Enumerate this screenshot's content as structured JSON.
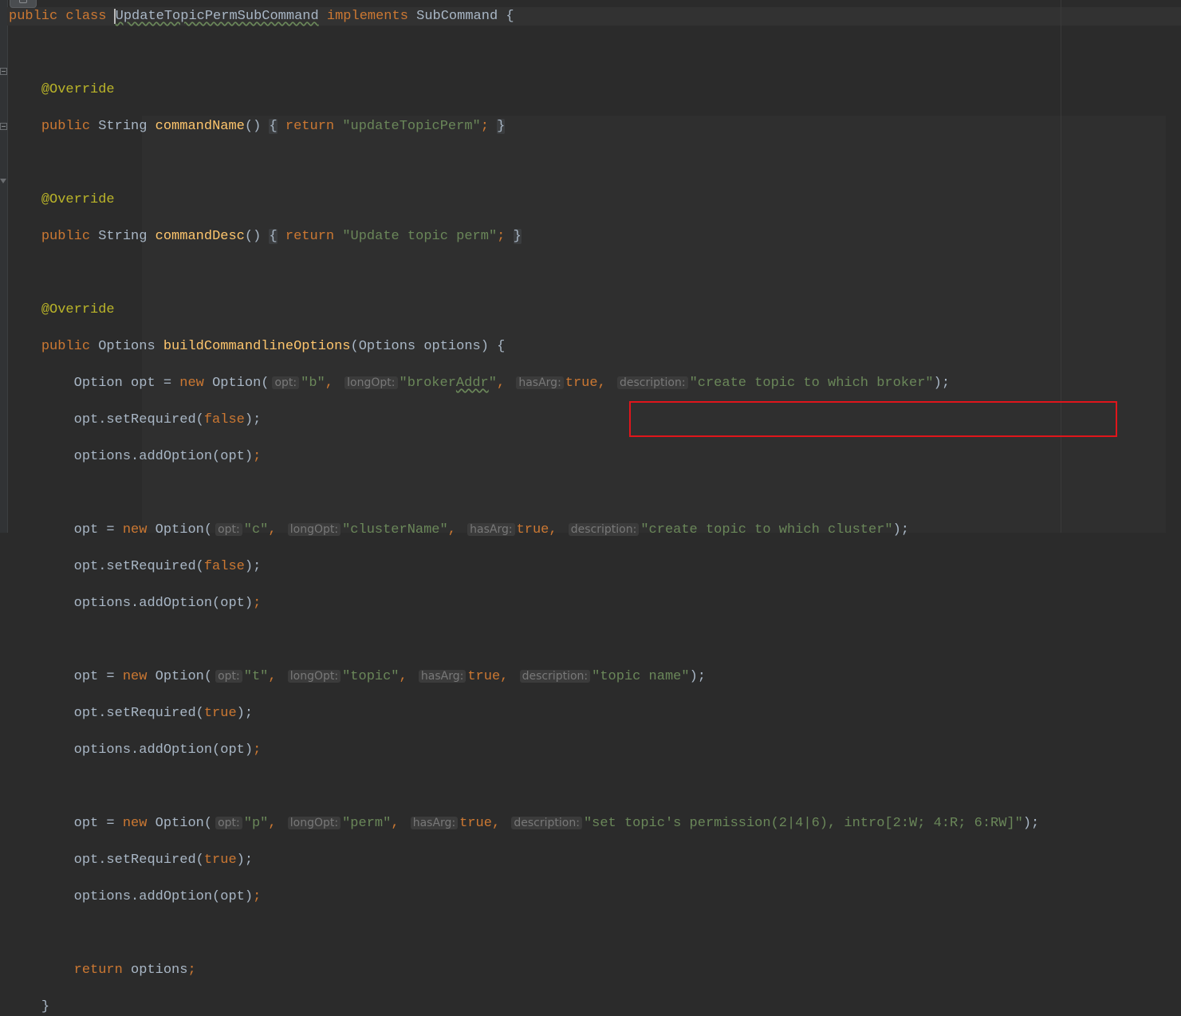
{
  "editor": {
    "class_decl": {
      "kw_public": "public",
      "kw_class": "class",
      "class_name": "UpdateTopicPermSubCommand",
      "kw_implements": "implements",
      "interface": "SubCommand",
      "open_brace": "{"
    },
    "annotation": "@Override",
    "method1": {
      "kw_public": "public",
      "type": "String",
      "name": "commandName",
      "parens": "()",
      "ob": "{",
      "kw_return": "return",
      "value": "\"updateTopicPerm\"",
      "semi": ";",
      "cb": "}"
    },
    "method2": {
      "kw_public": "public",
      "type": "String",
      "name": "commandDesc",
      "parens": "()",
      "ob": "{",
      "kw_return": "return",
      "value": "\"Update topic perm\"",
      "semi": ";",
      "cb": "}"
    },
    "method3": {
      "kw_public": "public",
      "type": "Options",
      "name": "buildCommandlineOptions",
      "params": "(Options options) {"
    },
    "hints": {
      "opt": "opt:",
      "longOpt": "longOpt:",
      "hasArg": "hasArg:",
      "description": "description:"
    },
    "kw_new": "new",
    "kw_true": "true",
    "kw_false": "false",
    "kw_return": "return",
    "option1": {
      "lhs": "Option opt = ",
      "ctor": "Option(",
      "opt": "\"b\"",
      "longOpt_a": "\"broker",
      "longOpt_b": "Addr",
      "longOpt_c": "\"",
      "description": "\"create topic to which broker\""
    },
    "option2": {
      "lhs": "opt = ",
      "ctor": "Option(",
      "opt": "\"c\"",
      "longOpt": "\"clusterName\"",
      "description": "\"create topic to which cluster\""
    },
    "option3": {
      "lhs": "opt = ",
      "ctor": "Option(",
      "opt": "\"t\"",
      "longOpt": "\"topic\"",
      "description": "\"topic name\""
    },
    "option4": {
      "lhs": "opt = ",
      "ctor": "Option(",
      "opt": "\"p\"",
      "longOpt": "\"perm\"",
      "description": "\"set topic's permission(2|4|6), intro[2:W; 4:R; 6:RW]\""
    },
    "set_required": "opt.setRequired(",
    "add_option": "options.addOption(opt)",
    "close_semi": ");",
    "comma": ",",
    "semi": ";",
    "options_ret": "options",
    "close_brace": "}"
  }
}
